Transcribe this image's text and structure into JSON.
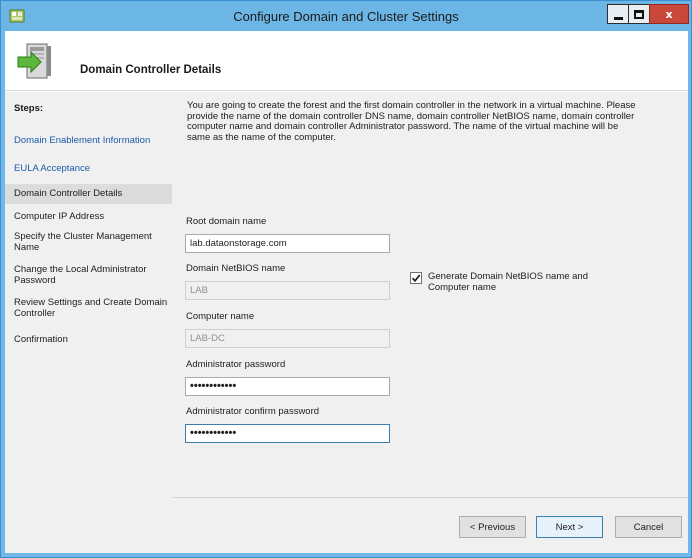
{
  "window": {
    "title": "Configure Domain and Cluster Settings",
    "accent_color": "#6cb6e6",
    "close_color": "#c9483a"
  },
  "header": {
    "title": "Domain Controller Details",
    "icon": "server-arrow-icon"
  },
  "sidebar": {
    "steps_label": "Steps:",
    "items": [
      {
        "label": "Domain Enablement Information",
        "state": "link"
      },
      {
        "label": "EULA Acceptance",
        "state": "link"
      },
      {
        "label": "Domain Controller Details",
        "state": "active"
      },
      {
        "label": "Computer IP Address",
        "state": "normal"
      },
      {
        "label": "Specify the Cluster Management Name",
        "state": "normal"
      },
      {
        "label": "Change the Local Administrator Password",
        "state": "normal"
      },
      {
        "label": "Review Settings and Create Domain Controller",
        "state": "normal"
      },
      {
        "label": "Confirmation",
        "state": "normal"
      }
    ]
  },
  "main": {
    "intro": "You are going to create the forest and the first domain controller in the network in a virtual machine. Please provide the name of the domain controller DNS name, domain controller NetBIOS name, domain controller computer name and domain controller Administrator password. The name of the virtual machine will be same as the name of the computer.",
    "root_domain_label": "Root domain name",
    "root_domain_value": "lab.dataonstorage.com",
    "netbios_label": "Domain NetBIOS name",
    "netbios_value": "LAB",
    "computer_name_label": "Computer name",
    "computer_name_value": "LAB-DC",
    "admin_password_label": "Administrator password",
    "admin_password_value": "••••••••••••",
    "admin_confirm_label": "Administrator confirm password",
    "admin_confirm_value": "••••••••••••",
    "generate_checkbox_label": "Generate Domain NetBIOS name and Computer name",
    "generate_checked": true
  },
  "footer": {
    "previous_label": "< Previous",
    "next_label": "Next >",
    "cancel_label": "Cancel"
  }
}
